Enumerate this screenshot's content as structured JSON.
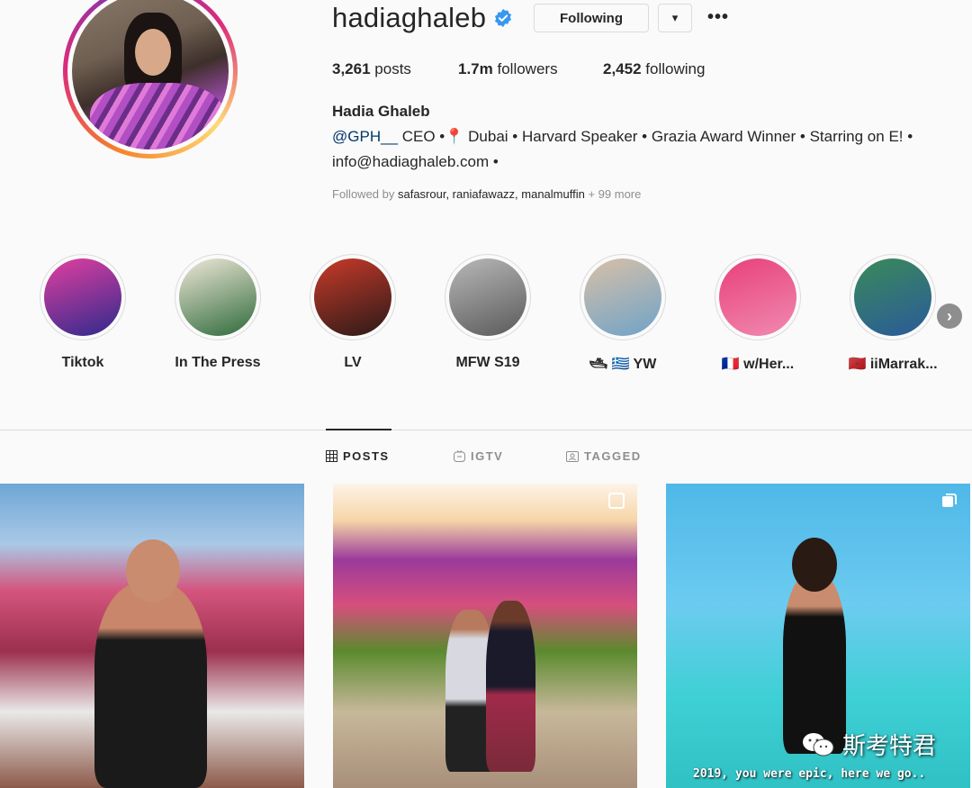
{
  "profile": {
    "username": "hadiaghaleb",
    "following_button": "Following",
    "dropdown_glyph": "▾",
    "more_glyph": "•••",
    "stats": {
      "posts_count": "3,261",
      "posts_label": "posts",
      "followers_count": "1.7m",
      "followers_label": "followers",
      "following_count": "2,452",
      "following_label": "following"
    },
    "full_name": "Hadia Ghaleb",
    "bio_handle": "@GPH__",
    "bio_line1_rest": " CEO •📍 Dubai • Harvard Speaker • Grazia Award Winner • Starring on E! •",
    "bio_line2": "info@hadiaghaleb.com •",
    "followed_by_prefix": "Followed by ",
    "followed_by_users": "safasrour, raniafawazz, manalmuffin",
    "followed_by_more": " + 99 more"
  },
  "highlights": [
    {
      "label": "Tiktok",
      "color_a": "#e23fa0",
      "color_b": "#2d2a8c"
    },
    {
      "label": "In The Press",
      "color_a": "#f0e8d8",
      "color_b": "#2e6a3a"
    },
    {
      "label": "LV",
      "color_a": "#c93a2a",
      "color_b": "#2a1a18"
    },
    {
      "label": "MFW S19",
      "color_a": "#b8b8b8",
      "color_b": "#5a5a5a"
    },
    {
      "label": "🛥 🇬🇷 YW",
      "color_a": "#d8c0a8",
      "color_b": "#6fa3c8"
    },
    {
      "label": "🇫🇷 w/Her...",
      "color_a": "#e8407a",
      "color_b": "#f08ab0"
    },
    {
      "label": "🇲🇦 iiMarrak...",
      "color_a": "#3a8a5a",
      "color_b": "#2a5a9a"
    }
  ],
  "highlights_next": "›",
  "tabs": [
    {
      "label": "POSTS",
      "icon": "grid-icon"
    },
    {
      "label": "IGTV",
      "icon": "igtv-icon"
    },
    {
      "label": "TAGGED",
      "icon": "tagged-icon"
    }
  ],
  "posts": [
    {
      "id": "post-1"
    },
    {
      "id": "post-2"
    },
    {
      "id": "post-3",
      "caption": "2019, you were epic, here we go.."
    }
  ],
  "watermark": "斯考特君",
  "colors": {
    "verified_blue": "#3897f0",
    "text_primary": "#262626",
    "text_secondary": "#8e8e8e",
    "link": "#00376b"
  }
}
